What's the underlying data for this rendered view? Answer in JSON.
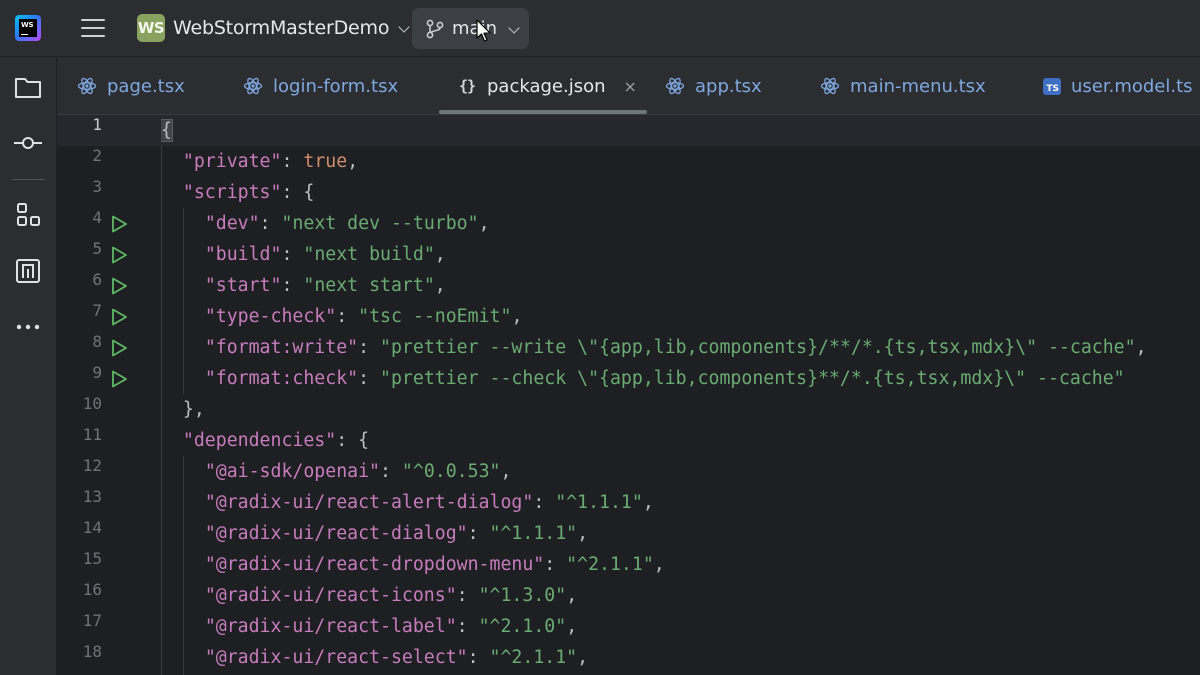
{
  "app": {
    "logo_text": "WS"
  },
  "project": {
    "badge": "WS",
    "name": "WebStormMasterDemo"
  },
  "branch": {
    "name": "main"
  },
  "toolstrip": {
    "items": [
      {
        "name": "project-view-icon"
      },
      {
        "name": "commit-icon"
      },
      {
        "name": "structure-icon"
      },
      {
        "name": "npm-icon"
      },
      {
        "name": "more-tools-icon"
      }
    ]
  },
  "tabs": [
    {
      "label": "page.tsx",
      "icon": "react-icon",
      "active": false
    },
    {
      "label": "login-form.tsx",
      "icon": "react-icon",
      "active": false
    },
    {
      "label": "package.json",
      "icon": "json-icon",
      "active": true,
      "close": "×"
    },
    {
      "label": "app.tsx",
      "icon": "react-icon",
      "active": false
    },
    {
      "label": "main-menu.tsx",
      "icon": "react-icon",
      "active": false
    },
    {
      "label": "user.model.ts",
      "icon": "ts-icon",
      "icon_text": "TS",
      "active": false
    }
  ],
  "editor": {
    "current_line": 1,
    "lines": [
      {
        "n": "1",
        "run": false,
        "tokens": [
          [
            "punc-hl",
            "{"
          ]
        ]
      },
      {
        "n": "2",
        "run": false,
        "tokens": [
          [
            "sp",
            "  "
          ],
          [
            "key",
            "\"private\""
          ],
          [
            "punc",
            ": "
          ],
          [
            "kw",
            "true"
          ],
          [
            "punc",
            ","
          ]
        ]
      },
      {
        "n": "3",
        "run": false,
        "tokens": [
          [
            "sp",
            "  "
          ],
          [
            "key",
            "\"scripts\""
          ],
          [
            "punc",
            ": {"
          ]
        ]
      },
      {
        "n": "4",
        "run": true,
        "tokens": [
          [
            "sp",
            "    "
          ],
          [
            "key",
            "\"dev\""
          ],
          [
            "punc",
            ": "
          ],
          [
            "str",
            "\"next dev --turbo\""
          ],
          [
            "punc",
            ","
          ]
        ]
      },
      {
        "n": "5",
        "run": true,
        "tokens": [
          [
            "sp",
            "    "
          ],
          [
            "key",
            "\"build\""
          ],
          [
            "punc",
            ": "
          ],
          [
            "str",
            "\"next build\""
          ],
          [
            "punc",
            ","
          ]
        ]
      },
      {
        "n": "6",
        "run": true,
        "tokens": [
          [
            "sp",
            "    "
          ],
          [
            "key",
            "\"start\""
          ],
          [
            "punc",
            ": "
          ],
          [
            "str",
            "\"next start\""
          ],
          [
            "punc",
            ","
          ]
        ]
      },
      {
        "n": "7",
        "run": true,
        "tokens": [
          [
            "sp",
            "    "
          ],
          [
            "key",
            "\"type-check\""
          ],
          [
            "punc",
            ": "
          ],
          [
            "str",
            "\"tsc --noEmit\""
          ],
          [
            "punc",
            ","
          ]
        ]
      },
      {
        "n": "8",
        "run": true,
        "tokens": [
          [
            "sp",
            "    "
          ],
          [
            "key",
            "\"format:write\""
          ],
          [
            "punc",
            ": "
          ],
          [
            "str",
            "\"prettier --write \\\"{app,lib,components}/**/*.{ts,tsx,mdx}\\\" --cache\""
          ],
          [
            "punc",
            ","
          ]
        ]
      },
      {
        "n": "9",
        "run": true,
        "tokens": [
          [
            "sp",
            "    "
          ],
          [
            "key",
            "\"format:check\""
          ],
          [
            "punc",
            ": "
          ],
          [
            "str",
            "\"prettier --check \\\"{app,lib,components}**/*.{ts,tsx,mdx}\\\" --cache\""
          ]
        ]
      },
      {
        "n": "10",
        "run": false,
        "tokens": [
          [
            "sp",
            "  "
          ],
          [
            "punc",
            "},"
          ]
        ]
      },
      {
        "n": "11",
        "run": false,
        "tokens": [
          [
            "sp",
            "  "
          ],
          [
            "key",
            "\"dependencies\""
          ],
          [
            "punc",
            ": {"
          ]
        ]
      },
      {
        "n": "12",
        "run": false,
        "tokens": [
          [
            "sp",
            "    "
          ],
          [
            "key",
            "\"@ai-sdk/openai\""
          ],
          [
            "punc",
            ": "
          ],
          [
            "str",
            "\"^0.0.53\""
          ],
          [
            "punc",
            ","
          ]
        ]
      },
      {
        "n": "13",
        "run": false,
        "tokens": [
          [
            "sp",
            "    "
          ],
          [
            "key",
            "\"@radix-ui/react-alert-dialog\""
          ],
          [
            "punc",
            ": "
          ],
          [
            "str",
            "\"^1.1.1\""
          ],
          [
            "punc",
            ","
          ]
        ]
      },
      {
        "n": "14",
        "run": false,
        "tokens": [
          [
            "sp",
            "    "
          ],
          [
            "key",
            "\"@radix-ui/react-dialog\""
          ],
          [
            "punc",
            ": "
          ],
          [
            "str",
            "\"^1.1.1\""
          ],
          [
            "punc",
            ","
          ]
        ]
      },
      {
        "n": "15",
        "run": false,
        "tokens": [
          [
            "sp",
            "    "
          ],
          [
            "key",
            "\"@radix-ui/react-dropdown-menu\""
          ],
          [
            "punc",
            ": "
          ],
          [
            "str",
            "\"^2.1.1\""
          ],
          [
            "punc",
            ","
          ]
        ]
      },
      {
        "n": "16",
        "run": false,
        "tokens": [
          [
            "sp",
            "    "
          ],
          [
            "key",
            "\"@radix-ui/react-icons\""
          ],
          [
            "punc",
            ": "
          ],
          [
            "str",
            "\"^1.3.0\""
          ],
          [
            "punc",
            ","
          ]
        ]
      },
      {
        "n": "17",
        "run": false,
        "tokens": [
          [
            "sp",
            "    "
          ],
          [
            "key",
            "\"@radix-ui/react-label\""
          ],
          [
            "punc",
            ": "
          ],
          [
            "str",
            "\"^2.1.0\""
          ],
          [
            "punc",
            ","
          ]
        ]
      },
      {
        "n": "18",
        "run": false,
        "tokens": [
          [
            "sp",
            "    "
          ],
          [
            "key",
            "\"@radix-ui/react-select\""
          ],
          [
            "punc",
            ": "
          ],
          [
            "str",
            "\"^2.1.1\""
          ],
          [
            "punc",
            ","
          ]
        ]
      }
    ]
  },
  "colors": {
    "background": "#1e1f22",
    "chrome": "#2b2d30",
    "key": "#c77dbb",
    "string": "#6aab73",
    "keyword": "#cf8e6d",
    "run_icon": "#5fb865",
    "tab_inactive": "#7fa7e0"
  }
}
